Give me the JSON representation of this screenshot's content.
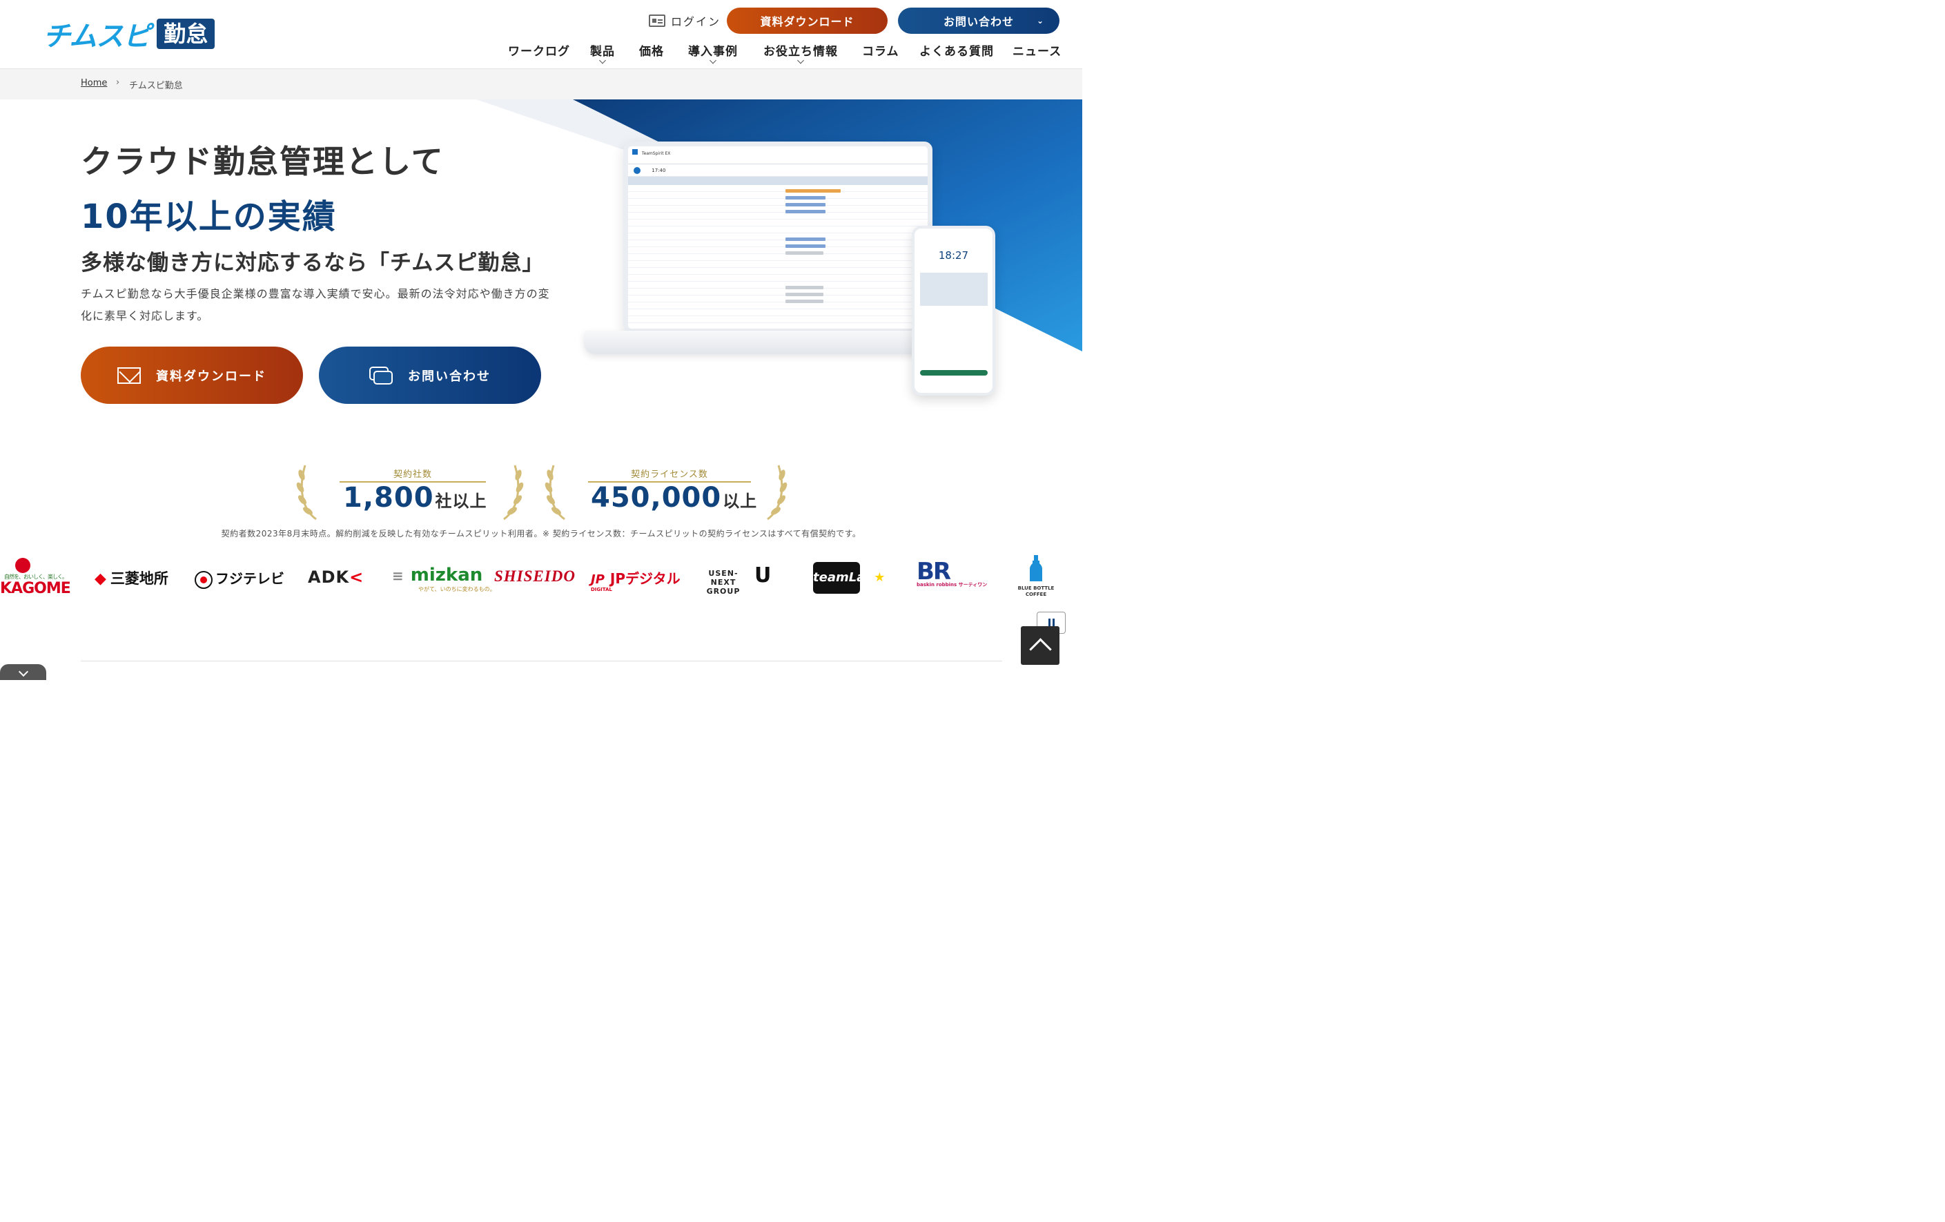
{
  "brand": {
    "logo_text": "チムスピ",
    "logo_badge": "勤怠"
  },
  "header": {
    "login_label": "ログイン",
    "download_label": "資料ダウンロード",
    "contact_label": "お問い合わせ"
  },
  "nav": [
    {
      "label": "ワークログ"
    },
    {
      "label": "製品"
    },
    {
      "label": "価格"
    },
    {
      "label": "導入事例"
    },
    {
      "label": "お役立ち情報"
    },
    {
      "label": "コラム"
    },
    {
      "label": "よくある質問"
    },
    {
      "label": "ニュース"
    }
  ],
  "breadcrumb": {
    "home": "Home",
    "current": "チムスピ勤怠"
  },
  "hero": {
    "title_line1": "クラウド勤怠管理として",
    "title_line2": "10年以上の実績",
    "subtitle": "多様な働き方に対応するなら「チムスピ勤怠」",
    "lead": "チムスピ勤怠なら大手優良企業様の豊富な導入実績で安心。最新の法令対応や働き方の変化に素早く対応します。",
    "download_label": "資料ダウンロード",
    "contact_label": "お問い合わせ"
  },
  "mockup": {
    "app_name": "TeamSpirit EX",
    "laptop_time": "17:40",
    "phone_time": "18:27"
  },
  "stats": [
    {
      "label": "契約社数",
      "value": "1,800",
      "suffix": "社以上"
    },
    {
      "label": "契約ライセンス数",
      "value": "450,000",
      "suffix": "以上"
    }
  ],
  "stats_note": "契約者数2023年8月末時点。解約削減を反映した有効なチームスピリット利用者。※ 契約ライセンス数：チームスピリットの契約ライセンスはすべて有償契約です。",
  "client_logos": [
    {
      "name": "KAGOME",
      "tagline": "自然を、おいしく、楽しく。"
    },
    {
      "name": "三菱地所"
    },
    {
      "name": "フジテレビ"
    },
    {
      "name": "ADK"
    },
    {
      "name": "mizkan",
      "tagline": "やがて、いのちに変わるもの。"
    },
    {
      "name": "SHISEIDO"
    },
    {
      "name": "JPデジタル",
      "tagline": "DIGITAL"
    },
    {
      "name": "USEN-NEXT GROUP"
    },
    {
      "name": "teamLab"
    },
    {
      "name": "BR",
      "tagline": "baskin robbins サーティワン"
    },
    {
      "name": "BLUE BOTTLE COFFEE"
    }
  ],
  "colors": {
    "brand_navy": "#10437c",
    "brand_orange": "#c9540d",
    "gold": "#c8ad5a"
  }
}
